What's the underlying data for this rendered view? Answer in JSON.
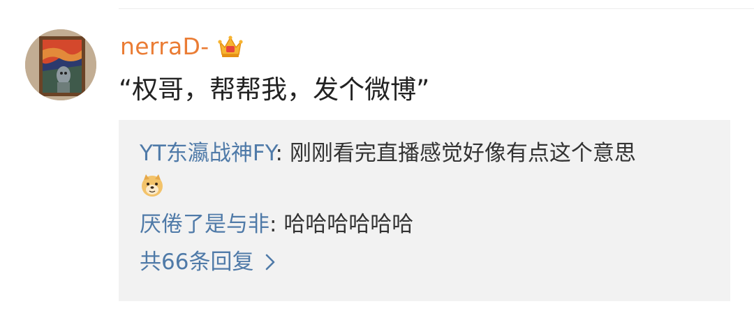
{
  "comment": {
    "username": "nerraD-",
    "username_color": "#ea7c34",
    "badge_icon": "vip-crown-icon",
    "text": "“权哥，帮帮我，发个微博”"
  },
  "replies": [
    {
      "user": "YT东瀛战神FY",
      "separator": ": ",
      "text": "刚刚看完直播感觉好像有点这个意思",
      "emoji_icon": "doge-emoji-icon"
    },
    {
      "user": "厌倦了是与非",
      "separator": ": ",
      "text": "哈哈哈哈哈哈"
    }
  ],
  "more_replies": {
    "label": "共66条回复"
  },
  "colors": {
    "link_blue": "#4f7aa8",
    "reply_bg": "#f2f2f2",
    "text": "#222222"
  }
}
